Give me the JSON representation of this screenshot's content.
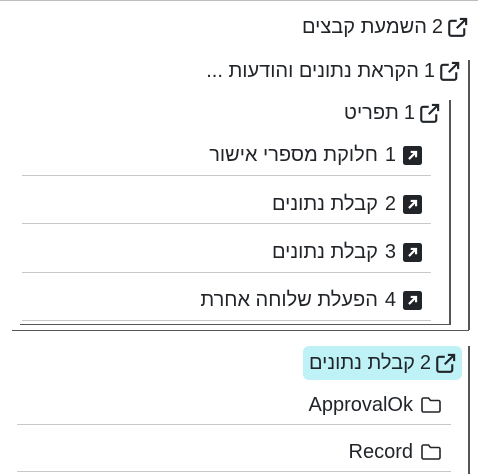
{
  "tree": {
    "level1": {
      "count": "2",
      "label": "השמעת קבצים",
      "icon": "external-link-icon"
    },
    "level2": {
      "count": "1",
      "label": "הקראת נתונים והודעות ...",
      "icon": "external-link-icon"
    },
    "level3": {
      "count": "1",
      "label": "תפריט",
      "icon": "external-link-icon"
    },
    "menu_items": [
      {
        "count": "1",
        "label": "חלוקת מספרי אישור",
        "icon": "square-arrow-up-right-icon"
      },
      {
        "count": "2",
        "label": "קבלת נתונים",
        "icon": "square-arrow-up-right-icon"
      },
      {
        "count": "3",
        "label": "קבלת נתונים",
        "icon": "square-arrow-up-right-icon"
      },
      {
        "count": "4",
        "label": "הפעלת שלוחה אחרת",
        "icon": "square-arrow-up-right-icon"
      }
    ],
    "selected": {
      "count": "2",
      "label": "קבלת נתונים",
      "icon": "external-link-icon",
      "highlight": "#bff2f6"
    },
    "folders": [
      {
        "label": "ApprovalOk",
        "icon": "folder-icon"
      },
      {
        "label": "Record",
        "icon": "folder-icon"
      }
    ]
  }
}
